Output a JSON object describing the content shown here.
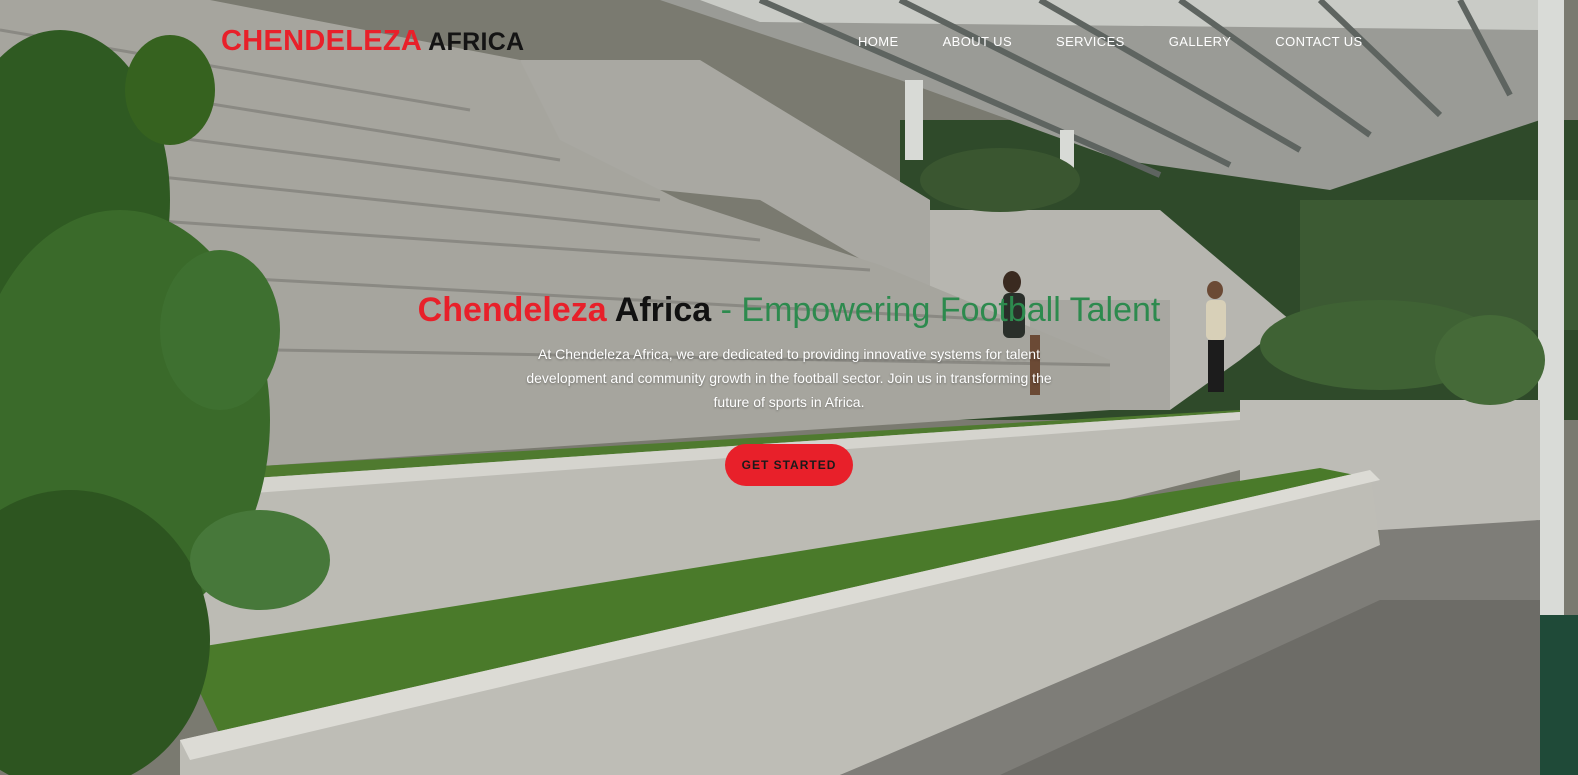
{
  "brand": {
    "primary": "CHENDELEZA",
    "secondary": "AFRICA"
  },
  "nav": {
    "items": [
      {
        "label": "HOME"
      },
      {
        "label": "ABOUT US"
      },
      {
        "label": "SERVICES"
      },
      {
        "label": "GALLERY"
      },
      {
        "label": "CONTACT US"
      }
    ]
  },
  "hero": {
    "title_part1": "Chendeleza",
    "title_part2": "Africa",
    "title_part3": "- Empowering Football Talent",
    "description": "At Chendeleza Africa, we are dedicated to providing innovative systems for talent development and community growth in the football sector. Join us in transforming the future of sports in Africa.",
    "cta_label": "GET STARTED"
  },
  "colors": {
    "brand_red": "#e8202a",
    "brand_dark": "#141414",
    "accent_green": "#2d8a4e",
    "nav_text": "#ffffff"
  }
}
